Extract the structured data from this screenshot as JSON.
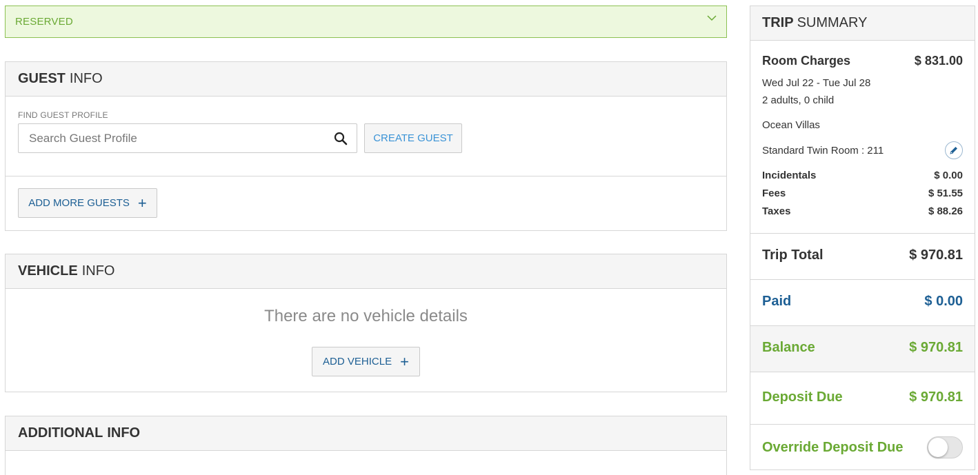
{
  "status": {
    "label": "RESERVED"
  },
  "guest_info": {
    "title_bold": "GUEST",
    "title_light": "INFO",
    "find_label": "FIND GUEST PROFILE",
    "search_placeholder": "Search Guest Profile",
    "create_guest_label": "CREATE GUEST",
    "add_more_guests_label": "ADD MORE GUESTS",
    "add_more_guests_icon": "plus-icon"
  },
  "vehicle_info": {
    "title_bold": "VEHICLE",
    "title_light": "INFO",
    "empty_message": "There are no vehicle details",
    "add_vehicle_label": "ADD VEHICLE",
    "add_vehicle_icon": "plus-icon"
  },
  "additional_info": {
    "title_bold": "ADDITIONAL",
    "title_light": "INFO"
  },
  "trip_summary": {
    "title_bold": "TRIP",
    "title_light": "SUMMARY",
    "room_charges_label": "Room Charges",
    "room_charges_value": "$ 831.00",
    "dates": "Wed Jul 22 - Tue Jul 28",
    "occupancy": "2 adults, 0 child",
    "property": "Ocean Villas",
    "room": "Standard Twin Room : 211",
    "fees": [
      {
        "label": "Incidentals",
        "value": "$ 0.00"
      },
      {
        "label": "Fees",
        "value": "$ 51.55"
      },
      {
        "label": "Taxes",
        "value": "$ 88.26"
      }
    ],
    "trip_total_label": "Trip Total",
    "trip_total_value": "$ 970.81",
    "paid_label": "Paid",
    "paid_value": "$ 0.00",
    "balance_label": "Balance",
    "balance_value": "$ 970.81",
    "deposit_due_label": "Deposit Due",
    "deposit_due_value": "$ 970.81",
    "override_label": "Override Deposit Due",
    "override_on": false
  },
  "colors": {
    "accent_green": "#6aa934",
    "accent_blue": "#1d5f94",
    "link_blue": "#3a93d6",
    "status_bg": "#edf8de"
  }
}
